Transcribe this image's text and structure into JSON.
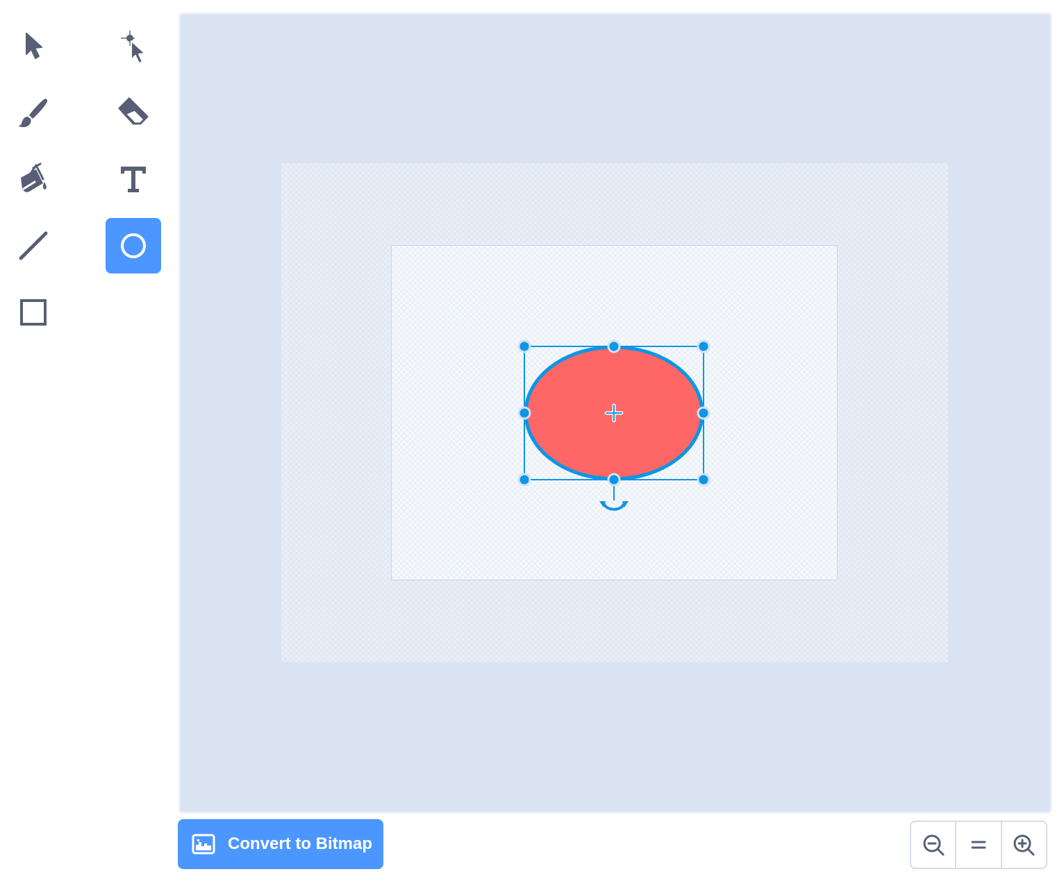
{
  "tools": [
    {
      "id": "select",
      "icon": "select-arrow-icon",
      "active": false
    },
    {
      "id": "reshape",
      "icon": "reshape-icon",
      "active": false
    },
    {
      "id": "brush",
      "icon": "brush-icon",
      "active": false
    },
    {
      "id": "eraser",
      "icon": "eraser-icon",
      "active": false
    },
    {
      "id": "fill",
      "icon": "fill-bucket-icon",
      "active": false
    },
    {
      "id": "text",
      "icon": "text-icon",
      "active": false
    },
    {
      "id": "line",
      "icon": "line-icon",
      "active": false
    },
    {
      "id": "circle",
      "icon": "circle-icon",
      "active": true
    },
    {
      "id": "rectangle",
      "icon": "rectangle-icon",
      "active": false
    }
  ],
  "colors": {
    "accent": "#4c97ff",
    "icon": "#575e75",
    "shape_fill": "#ff6666",
    "shape_stroke": "#0b96e6",
    "selection": "#0b96e6",
    "canvas_background": "#d9e3f2"
  },
  "canvas": {
    "shape": {
      "type": "ellipse",
      "selected": true
    }
  },
  "bottom_bar": {
    "convert_button": {
      "label": "Convert to Bitmap",
      "icon": "bitmap-image-icon"
    },
    "zoom": {
      "zoom_out_icon": "zoom-out-icon",
      "reset_icon": "zoom-reset-equals-icon",
      "zoom_in_icon": "zoom-in-icon"
    }
  }
}
